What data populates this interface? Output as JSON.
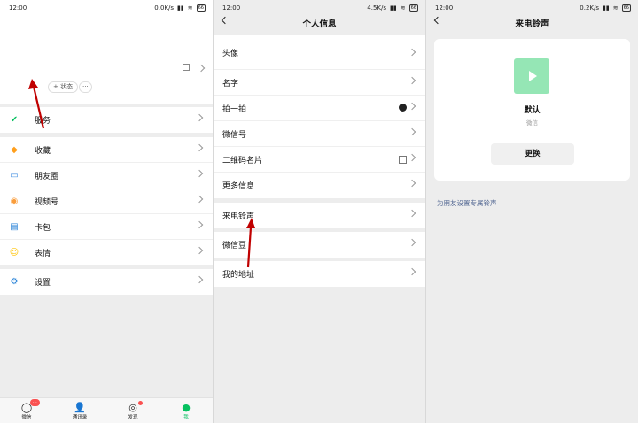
{
  "panel1": {
    "status": {
      "time": "12:00",
      "speed": "0.0K/s",
      "battery": "66"
    },
    "profile": {
      "status_button": "+ 状态",
      "more_button": "···"
    },
    "items": [
      {
        "label": "服务",
        "icon": "service-icon",
        "color": "#07c160"
      },
      {
        "label": "收藏",
        "icon": "favorites-icon",
        "color": "#ff9f1c"
      },
      {
        "label": "朋友圈",
        "icon": "moments-icon",
        "color": "#3d8be0"
      },
      {
        "label": "视频号",
        "icon": "channels-icon",
        "color": "#fa9d3b"
      },
      {
        "label": "卡包",
        "icon": "card-icon",
        "color": "#2782d7"
      },
      {
        "label": "表情",
        "icon": "sticker-icon",
        "color": "#ffc300"
      },
      {
        "label": "设置",
        "icon": "settings-icon",
        "color": "#2782d7"
      }
    ],
    "tabs": [
      {
        "label": "微信",
        "icon": "chat-icon",
        "badge": "···"
      },
      {
        "label": "通讯录",
        "icon": "contacts-icon"
      },
      {
        "label": "发现",
        "icon": "discover-icon"
      },
      {
        "label": "我",
        "icon": "me-icon"
      }
    ]
  },
  "panel2": {
    "status": {
      "time": "12:00",
      "speed": "4.5K/s",
      "battery": "66"
    },
    "title": "个人信息",
    "items": [
      "头像",
      "名字",
      "拍一拍",
      "微信号",
      "二维码名片",
      "更多信息",
      "来电铃声",
      "微信豆",
      "我的地址"
    ]
  },
  "panel3": {
    "status": {
      "time": "12:00",
      "speed": "0.2K/s",
      "battery": "66"
    },
    "title": "来电铃声",
    "ringtone_name": "默认",
    "ringtone_source": "微信",
    "change_button": "更换",
    "friend_link": "为朋友设置专属铃声"
  },
  "colors": {
    "accent": "#07c160",
    "link": "#576b95",
    "arrow": "#c00000",
    "play_bg": "#95e6b5"
  }
}
